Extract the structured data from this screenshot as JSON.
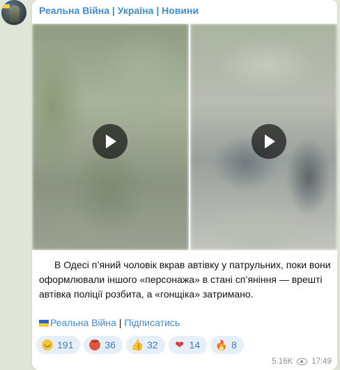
{
  "channel": {
    "name": "Реальна Війна | Україна | Новини"
  },
  "post": {
    "text": "В Одесі п’яний чоловік вкрав автівку у патрульних, поки вони оформлювали іншого «персонажа» в стані сп’яніння — врешті автівка поліції розбита, а «гонщіка» затримано.",
    "signature": {
      "channel_link": "Реальна Війна",
      "separator": " | ",
      "subscribe_link": "Підписатись"
    }
  },
  "media": [
    {
      "type": "video",
      "icon": "play-icon"
    },
    {
      "type": "video",
      "icon": "play-icon"
    }
  ],
  "reactions": [
    {
      "emoji": "laughing-face",
      "count": "191"
    },
    {
      "emoji": "angry-face",
      "count": "36"
    },
    {
      "emoji": "thumbs-up",
      "count": "32"
    },
    {
      "emoji": "heart",
      "count": "14"
    },
    {
      "emoji": "fire",
      "count": "8"
    }
  ],
  "footer": {
    "views": "5.16K",
    "time": "17:49"
  },
  "colors": {
    "accent": "#3f8ccf",
    "background": "#dfe6d8",
    "reaction_bg": "#e6eff8"
  }
}
